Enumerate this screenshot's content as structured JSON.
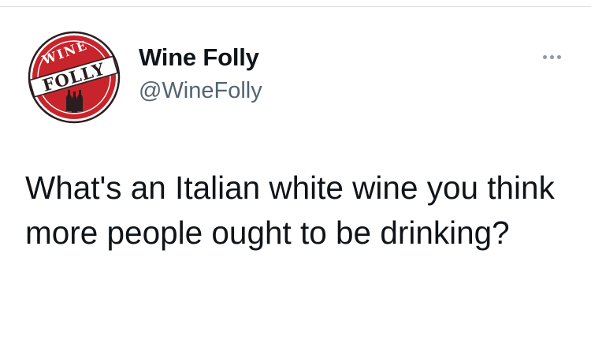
{
  "account": {
    "display_name": "Wine Folly",
    "handle": "@WineFolly",
    "avatar": {
      "icon": "wine-folly-logo-icon",
      "top_text": "WINE",
      "bottom_text": "FOLLY"
    }
  },
  "tweet": {
    "text": "What's an Italian white wine you think more people ought to be drinking?"
  },
  "menu": {
    "icon": "more-options-icon"
  },
  "colors": {
    "logo_red": "#c8242b",
    "logo_dark": "#2b1d1f",
    "handle_gray": "#536471",
    "text": "#0f1419"
  }
}
